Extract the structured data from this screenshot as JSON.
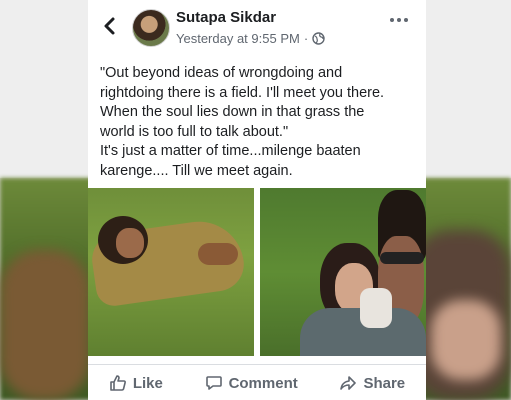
{
  "post": {
    "author": "Sutapa Sikdar",
    "timestamp": "Yesterday at 9:55 PM",
    "separator": "·",
    "privacy_icon": "globe-icon",
    "text_lines": [
      "\"Out beyond ideas of wrongdoing and",
      "rightdoing there is a field. I'll meet you there.",
      "When the soul lies down in that grass the",
      "world is too full to talk about.\"",
      "It's just a matter of time...milenge baaten",
      "karenge.... Till we meet again."
    ]
  },
  "actions": {
    "like_label": "Like",
    "comment_label": "Comment",
    "share_label": "Share"
  },
  "icons": {
    "back": "chevron-left-icon",
    "more": "more-horizontal-icon",
    "like": "thumbs-up-icon",
    "comment": "comment-icon",
    "share": "share-icon"
  },
  "colors": {
    "text_primary": "#1c1e21",
    "text_secondary": "#606770",
    "divider": "#dadde1"
  }
}
